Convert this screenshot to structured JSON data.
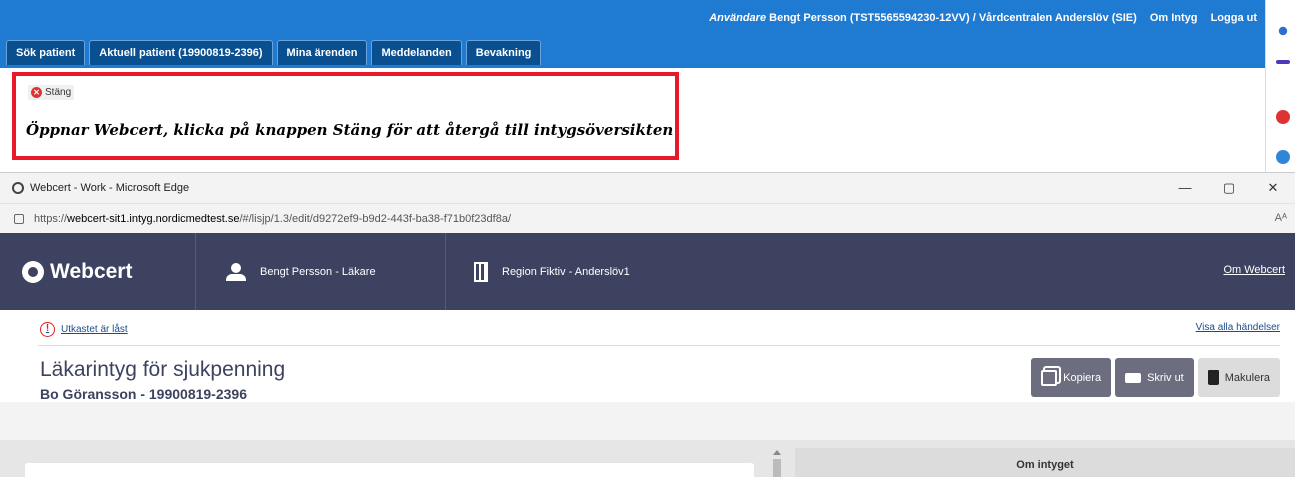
{
  "top_header": {
    "user_label": "Användare",
    "user_text": "Bengt Persson (TST5565594230-12VV) / Vårdcentralen Anderslöv (SIE)",
    "links": [
      "Om Intyg",
      "Logga ut"
    ],
    "tabs": [
      "Sök patient",
      "Aktuell patient (19900819-2396)",
      "Mina ärenden",
      "Meddelanden",
      "Bevakning"
    ]
  },
  "notice": {
    "close_label": "Stäng",
    "instruction": "Öppnar Webcert, klicka på knappen Stäng för att återgå till intygsöversikten"
  },
  "browser": {
    "title": "Webcert - Work - Microsoft Edge",
    "controls": [
      "—",
      "▢",
      "✕"
    ],
    "url_prefix": "https://",
    "url_domain": "webcert-sit1.intyg.nordicmedtest.se",
    "url_path": "/#/lisjp/1.3/edit/d9272ef9-b9d2-443f-ba38-f71b0f23df8a/",
    "read_aloud": "Aᴬ"
  },
  "app": {
    "brand": "Webcert",
    "user": "Bengt Persson - Läkare",
    "unit": "Region Fiktiv - Anderslöv1",
    "about": "Om Webcert",
    "locked_text": "Utkastet är låst",
    "events_link": "Visa alla händelser",
    "doc_title": "Läkarintyg för sjukpenning",
    "patient": "Bo Göransson - 19900819-2396",
    "buttons": {
      "copy": "Kopiera",
      "print": "Skriv ut",
      "void": "Makulera"
    },
    "side_panel_title": "Om intyget"
  },
  "colors": {
    "header_blue": "#1f7ad1",
    "tab_blue": "#0a4f8f",
    "nav_dark": "#3d4260",
    "highlight_red": "#e8192a"
  }
}
